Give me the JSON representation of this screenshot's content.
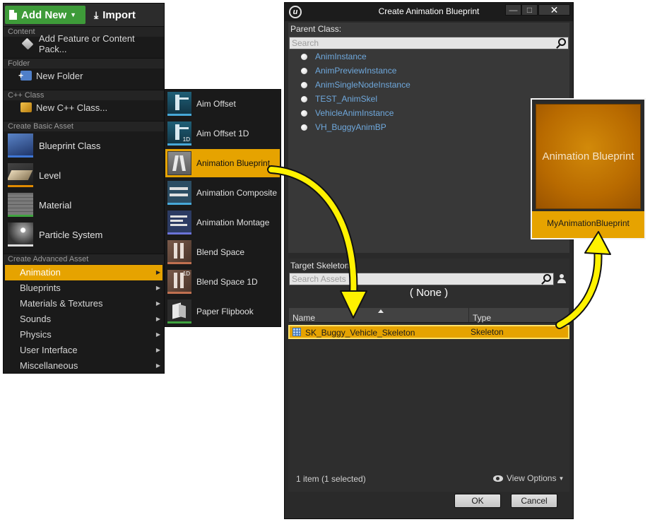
{
  "toolbar": {
    "add_new_label": "Add New",
    "import_label": "Import"
  },
  "content_menu": {
    "sections": {
      "content": "Content",
      "folder": "Folder",
      "cpp": "C++ Class",
      "basic": "Create Basic Asset",
      "advanced": "Create Advanced Asset"
    },
    "content_item": "Add Feature or Content Pack...",
    "folder_item": "New Folder",
    "cpp_item": "New C++ Class...",
    "basic_assets": [
      "Blueprint Class",
      "Level",
      "Material",
      "Particle System"
    ],
    "advanced_categories": [
      "Animation",
      "Blueprints",
      "Materials & Textures",
      "Sounds",
      "Physics",
      "User Interface",
      "Miscellaneous"
    ]
  },
  "animation_submenu": [
    "Aim Offset",
    "Aim Offset 1D",
    "Animation Blueprint",
    "Animation Composite",
    "Animation Montage",
    "Blend Space",
    "Blend Space 1D",
    "Paper Flipbook"
  ],
  "dialog": {
    "title": "Create Animation Blueprint",
    "parent_class_label": "Parent Class:",
    "parent_search_placeholder": "Search",
    "parent_classes": [
      "AnimInstance",
      "AnimPreviewInstance",
      "AnimSingleNodeInstance",
      "TEST_AnimSkel",
      "VehicleAnimInstance",
      "VH_BuggyAnimBP"
    ],
    "target_skeleton_label": "Target Skeleton",
    "skeleton_search_placeholder": "Search Assets",
    "none_option": "( None )",
    "columns": {
      "name": "Name",
      "type": "Type"
    },
    "rows": [
      {
        "name": "SK_Buggy_Vehicle_Skeleton",
        "type": "Skeleton"
      }
    ],
    "item_count": "1 item (1 selected)",
    "view_options": "View Options",
    "ok_label": "OK",
    "cancel_label": "Cancel",
    "window_controls": {
      "minimize": "—",
      "maximize": "□",
      "close": "✕"
    }
  },
  "result_tile": {
    "thumbnail_text": "Animation Blueprint",
    "asset_name": "MyAnimationBlueprint"
  },
  "colors": {
    "accent": "#e6a300",
    "add_new": "#3e9b39",
    "highlight_outline": "#ffe36b",
    "arrow": "#fff200",
    "class_link": "#6fa8dc"
  }
}
